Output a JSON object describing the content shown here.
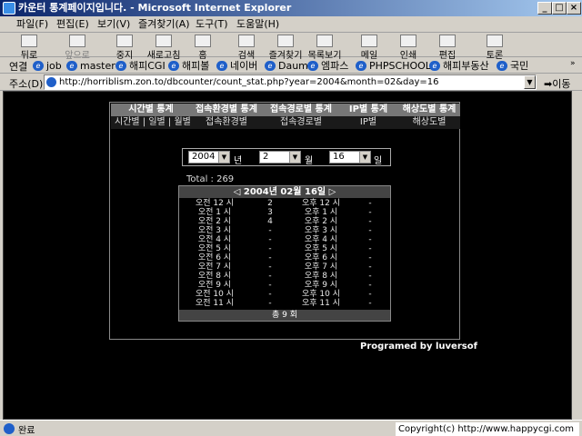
{
  "window": {
    "title": "카운터 통계페이지입니다. - Microsoft Internet Explorer",
    "min": "_",
    "max": "□",
    "close": "×"
  },
  "menu": [
    "파일(F)",
    "편집(E)",
    "보기(V)",
    "즐겨찾기(A)",
    "도구(T)",
    "도움말(H)"
  ],
  "toolbar": [
    "뒤로",
    "앞으로",
    "중지",
    "새로고침",
    "홈",
    "검색",
    "즐겨찾기",
    "목록보기",
    "메일",
    "인쇄",
    "편집",
    "토론"
  ],
  "links": {
    "label": "연결",
    "items": [
      "job",
      "master",
      "해피CGI",
      "해피볼",
      "네이버",
      "Daum",
      "엠파스",
      "PHPSCHOOL",
      "해피부동산",
      "국민"
    ]
  },
  "address": {
    "label": "주소(D)",
    "url": "http://horriblism.zon.to/dbcounter/count_stat.php?year=2004&month=02&day=16",
    "go": "이동"
  },
  "nav": {
    "top": [
      "시간별 통계",
      "접속환경별 통계",
      "접속경로별 통계",
      "IP별 통계",
      "해상도별 통계"
    ],
    "sub": [
      "시간별 | 일별 | 월별",
      "접속환경별",
      "접속경로별",
      "IP별",
      "해상도별"
    ]
  },
  "date_select": {
    "year": "2004",
    "year_unit": "년",
    "month": "2",
    "month_unit": "월",
    "day": "16",
    "day_unit": "일"
  },
  "total_label": "Total : 269",
  "day_table": {
    "header": "◁ 2004년 02월 16일 ▷",
    "rows": [
      {
        "am": "오전 12 시",
        "am_v": "2",
        "pm": "오후 12 시",
        "pm_v": "-"
      },
      {
        "am": "오전 1 시",
        "am_v": "3",
        "pm": "오후 1 시",
        "pm_v": "-"
      },
      {
        "am": "오전 2 시",
        "am_v": "4",
        "pm": "오후 2 시",
        "pm_v": "-"
      },
      {
        "am": "오전 3 시",
        "am_v": "-",
        "pm": "오후 3 시",
        "pm_v": "-"
      },
      {
        "am": "오전 4 시",
        "am_v": "-",
        "pm": "오후 4 시",
        "pm_v": "-"
      },
      {
        "am": "오전 5 시",
        "am_v": "-",
        "pm": "오후 5 시",
        "pm_v": "-"
      },
      {
        "am": "오전 6 시",
        "am_v": "-",
        "pm": "오후 6 시",
        "pm_v": "-"
      },
      {
        "am": "오전 7 시",
        "am_v": "-",
        "pm": "오후 7 시",
        "pm_v": "-"
      },
      {
        "am": "오전 8 시",
        "am_v": "-",
        "pm": "오후 8 시",
        "pm_v": "-"
      },
      {
        "am": "오전 9 시",
        "am_v": "-",
        "pm": "오후 9 시",
        "pm_v": "-"
      },
      {
        "am": "오전 10 시",
        "am_v": "-",
        "pm": "오후 10 시",
        "pm_v": "-"
      },
      {
        "am": "오전 11 시",
        "am_v": "-",
        "pm": "오후 11 시",
        "pm_v": "-"
      }
    ],
    "total": "총 9 회"
  },
  "credit": "Programed by luversof",
  "status": {
    "text": "완료",
    "copyright": "Copyright(c) http://www.happycgi.com"
  }
}
